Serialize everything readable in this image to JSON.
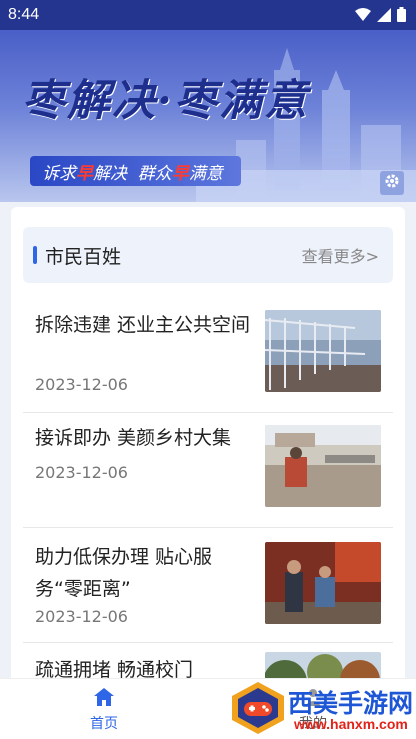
{
  "status_bar": {
    "time": "8:44"
  },
  "banner": {
    "title": "枣解决·枣满意",
    "subtitle_parts": [
      "诉求",
      "早",
      "解决  群众",
      "早",
      "满意"
    ]
  },
  "section": {
    "title": "市民百姓",
    "more_label": "查看更多>"
  },
  "news": [
    {
      "title": "拆除违建  还业主公共空间",
      "date": "2023-12-06"
    },
    {
      "title": "接诉即办  美颜乡村大集",
      "date": "2023-12-06"
    },
    {
      "title": "助力低保办理  贴心服务“零距离”",
      "date": "2023-12-06"
    },
    {
      "title": "疏通拥堵  畅通校门",
      "date": ""
    }
  ],
  "bottom_nav": {
    "home_label": "首页",
    "mine_label": "我的"
  },
  "watermark": {
    "text": "西美手游网",
    "url": "www.hanxm.com"
  },
  "colors": {
    "accent": "#2f66e8",
    "status_bar": "#24358f",
    "highlight": "#ff3b30"
  }
}
